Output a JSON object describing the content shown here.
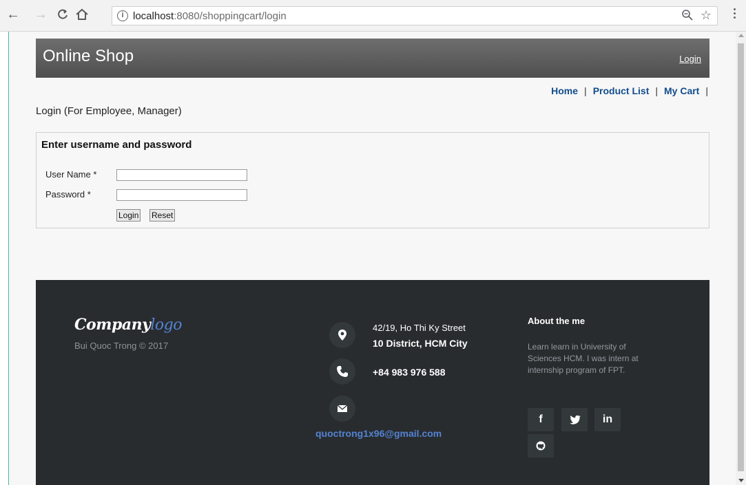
{
  "browser": {
    "url_host": "localhost",
    "url_rest": ":8080/shoppingcart/login",
    "info_icon": "i"
  },
  "header": {
    "title": "Online Shop",
    "login_link": "Login"
  },
  "menu": {
    "items": [
      "Home",
      "Product List",
      "My Cart"
    ],
    "separator": "|"
  },
  "page": {
    "heading": "Login (For Employee, Manager)"
  },
  "login_form": {
    "title": "Enter username and password",
    "username_label": "User Name *",
    "username_value": "",
    "password_label": "Password *",
    "password_value": "",
    "login_button": "Login",
    "reset_button": "Reset"
  },
  "footer": {
    "logo_main": "Company",
    "logo_accent": "logo",
    "copyright": "Bui Quoc Trong © 2017",
    "address_line1": "42/19, Ho Thi Ky Street",
    "address_line2": "10 District, HCM City",
    "phone": "+84 983 976 588",
    "email": "quoctrong1x96@gmail.com",
    "about_title": "About the me",
    "about_text": "Learn learn in University of Sciences HCM. I was intern at internship program of FPT.",
    "social": {
      "facebook": "f",
      "linkedin": "in"
    }
  },
  "colors": {
    "header_bg": "#5e5e5e",
    "menu_link": "#134d8c",
    "footer_bg": "#292c2f",
    "footer_accent": "#5383d3"
  }
}
